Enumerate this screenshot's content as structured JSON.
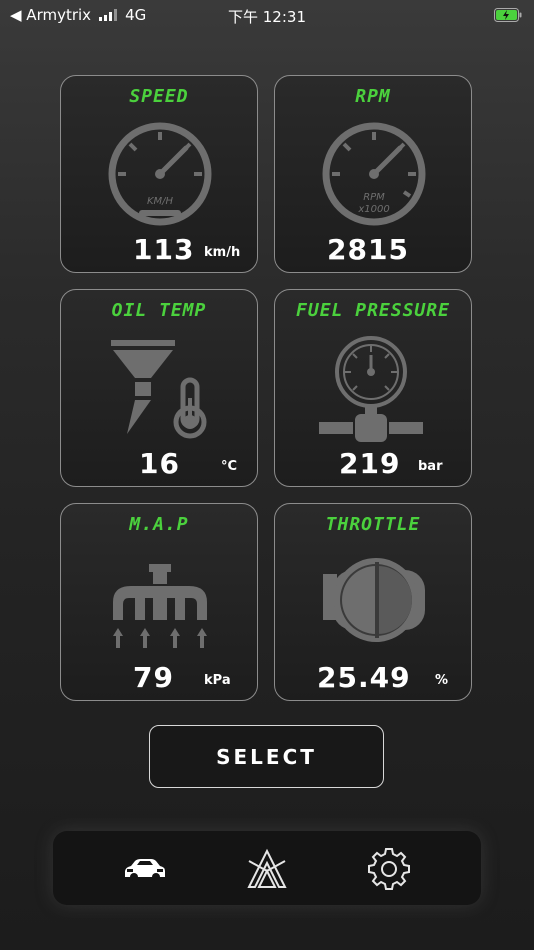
{
  "status_bar": {
    "carrier": "◀ Armytrix",
    "network": "4G",
    "time": "下午 12:31",
    "battery_color": "#4bd13d"
  },
  "theme": {
    "accent": "#4bd13d",
    "card_border": "#8c8c8c",
    "icon_gray": "#6e6e6e"
  },
  "gauges": {
    "speed": {
      "title": "SPEED",
      "icon": "speedometer-icon",
      "dial_label": "KM/H",
      "value": "113",
      "unit": "km/h"
    },
    "rpm": {
      "title": "RPM",
      "icon": "tachometer-icon",
      "dial_label_1": "RPM",
      "dial_label_2": "x1000",
      "value": "2815",
      "unit": ""
    },
    "oil_temp": {
      "title": "OIL TEMP",
      "icon": "oil-temp-icon",
      "value": "16",
      "unit": "°C"
    },
    "fuel": {
      "title": "FUEL PRESSURE",
      "icon": "pressure-gauge-icon",
      "value": "219",
      "unit": "bar"
    },
    "map": {
      "title": "M.A.P",
      "icon": "intake-manifold-icon",
      "value": "79",
      "unit": "kPa"
    },
    "throttle": {
      "title": "THROTTLE",
      "icon": "throttle-body-icon",
      "value": "25.49",
      "unit": "%"
    }
  },
  "select_button": {
    "label": "SELECT"
  },
  "bottom_nav": {
    "items": [
      {
        "icon": "car-icon"
      },
      {
        "icon": "armytrix-logo-icon"
      },
      {
        "icon": "gear-icon"
      }
    ]
  }
}
